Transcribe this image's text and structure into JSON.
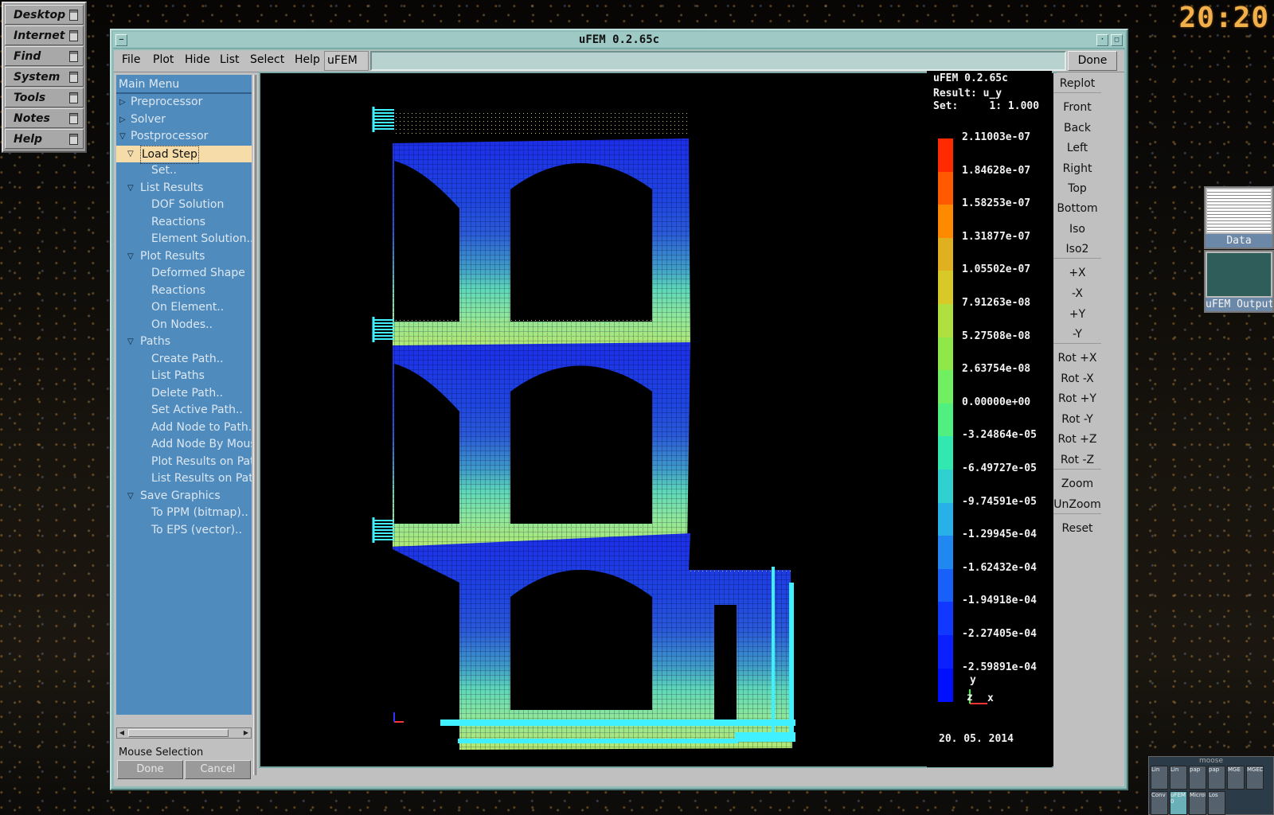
{
  "clock": "20:20",
  "launcher": [
    "Desktop",
    "Internet",
    "Find",
    "System",
    "Tools",
    "Notes",
    "Help"
  ],
  "thumbnails": [
    {
      "caption": "Data"
    },
    {
      "caption": "uFEM Output"
    }
  ],
  "pager": {
    "title": "moose",
    "cells": [
      "Lin",
      "Lin",
      "pap",
      "pap",
      "MGE",
      "MGED",
      "Conv",
      "uFEM 0",
      "MicroDe",
      "Los"
    ]
  },
  "window": {
    "title": "uFEM 0.2.65c",
    "menu": [
      "File",
      "Plot",
      "Hide",
      "List",
      "Select",
      "Help"
    ],
    "command_label": "uFEM >",
    "command_value": "",
    "done_label": "Done"
  },
  "tree": {
    "header": "Main Menu",
    "items": [
      {
        "label": "Preprocessor",
        "level": 0,
        "expanded": false
      },
      {
        "label": "Solver",
        "level": 0,
        "expanded": false
      },
      {
        "label": "Postprocessor",
        "level": 0,
        "expanded": true
      },
      {
        "label": "Load Step",
        "level": 1,
        "expanded": true,
        "selected": true
      },
      {
        "label": "Set..",
        "level": 2
      },
      {
        "label": "List Results",
        "level": 1,
        "expanded": true
      },
      {
        "label": "DOF Solution",
        "level": 2
      },
      {
        "label": "Reactions",
        "level": 2
      },
      {
        "label": "Element Solution..",
        "level": 2
      },
      {
        "label": "Plot Results",
        "level": 1,
        "expanded": true
      },
      {
        "label": "Deformed Shape",
        "level": 2
      },
      {
        "label": "Reactions",
        "level": 2
      },
      {
        "label": "On Element..",
        "level": 2
      },
      {
        "label": "On Nodes..",
        "level": 2
      },
      {
        "label": "Paths",
        "level": 1,
        "expanded": true
      },
      {
        "label": "Create Path..",
        "level": 2
      },
      {
        "label": "List Paths",
        "level": 2
      },
      {
        "label": "Delete Path..",
        "level": 2
      },
      {
        "label": "Set Active Path..",
        "level": 2
      },
      {
        "label": "Add Node to Path..",
        "level": 2
      },
      {
        "label": "Add Node By Mouse",
        "level": 2
      },
      {
        "label": "Plot Results on Path",
        "level": 2
      },
      {
        "label": "List Results on Path",
        "level": 2
      },
      {
        "label": "Save Graphics",
        "level": 1,
        "expanded": true
      },
      {
        "label": "To PPM (bitmap)..",
        "level": 2
      },
      {
        "label": "To EPS (vector)..",
        "level": 2
      }
    ]
  },
  "mouse_selection": {
    "title": "Mouse Selection",
    "done": "Done",
    "cancel": "Cancel"
  },
  "plot": {
    "header_lines": [
      "uFEM 0.2.65c",
      "Result: u_y",
      "Set:     1: 1.000"
    ],
    "legend": {
      "values": [
        "2.11003e-07",
        "1.84628e-07",
        "1.58253e-07",
        "1.31877e-07",
        "1.05502e-07",
        "7.91263e-08",
        "5.27508e-08",
        "2.63754e-08",
        "0.00000e+00",
        "-3.24864e-05",
        "-6.49727e-05",
        "-9.74591e-05",
        "-1.29945e-04",
        "-1.62432e-04",
        "-1.94918e-04",
        "-2.27405e-04",
        "-2.59891e-04"
      ],
      "colors": [
        "#ff2a00",
        "#ff5a00",
        "#ff8a00",
        "#e0b020",
        "#d8c828",
        "#b0e040",
        "#90e848",
        "#70f060",
        "#50f080",
        "#30e8b0",
        "#30d0d0",
        "#28b0e8",
        "#2088f0",
        "#1860f8",
        "#1038ff",
        "#0a20ff",
        "#0010ff"
      ]
    },
    "axes": {
      "y": "y",
      "z": "z",
      "x": "x"
    },
    "date": "20. 05. 2014"
  },
  "view_buttons": [
    "Replot",
    "Front",
    "Back",
    "Left",
    "Right",
    "Top",
    "Bottom",
    "Iso",
    "Iso2",
    "+X",
    "-X",
    "+Y",
    "-Y",
    "Rot +X",
    "Rot -X",
    "Rot +Y",
    "Rot -Y",
    "Rot +Z",
    "Rot -Z",
    "Zoom",
    "UnZoom",
    "Reset"
  ]
}
